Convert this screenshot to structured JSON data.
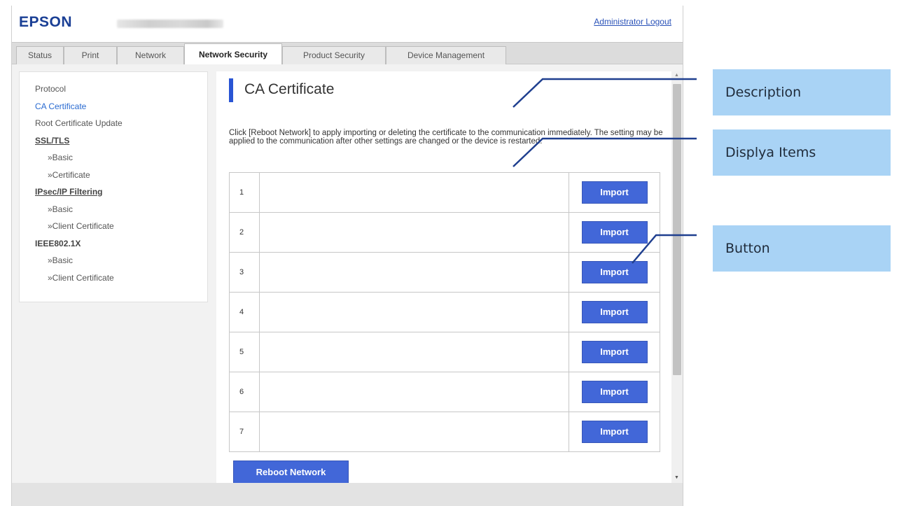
{
  "header": {
    "logo": "EPSON",
    "admin_logout": "Administrator Logout"
  },
  "tabs": [
    {
      "label": "Status"
    },
    {
      "label": "Print"
    },
    {
      "label": "Network"
    },
    {
      "label": "Network Security",
      "active": true
    },
    {
      "label": "Product Security"
    },
    {
      "label": "Device Management"
    }
  ],
  "sidebar": {
    "items": [
      {
        "label": "Protocol"
      },
      {
        "label": "CA Certificate",
        "current": true
      },
      {
        "label": "Root Certificate Update"
      },
      {
        "label": "SSL/TLS"
      },
      {
        "label": "»Basic"
      },
      {
        "label": "»Certificate"
      },
      {
        "label": "IPsec/IP Filtering"
      },
      {
        "label": "»Basic"
      },
      {
        "label": "»Client Certificate"
      },
      {
        "label": "IEEE802.1X"
      },
      {
        "label": "»Basic"
      },
      {
        "label": "»Client Certificate"
      }
    ]
  },
  "main": {
    "title": "CA Certificate",
    "description": "Click [Reboot Network] to apply importing or deleting the certificate to the communication immediately. The setting may be applied to the communication after other settings are changed or the device is restarted.",
    "rows": [
      {
        "num": "1",
        "button": "Import"
      },
      {
        "num": "2",
        "button": "Import"
      },
      {
        "num": "3",
        "button": "Import"
      },
      {
        "num": "4",
        "button": "Import"
      },
      {
        "num": "5",
        "button": "Import"
      },
      {
        "num": "6",
        "button": "Import"
      },
      {
        "num": "7",
        "button": "Import"
      }
    ],
    "reboot_button": "Reboot Network"
  },
  "annotations": [
    {
      "label": "Description"
    },
    {
      "label": "Displya Items"
    },
    {
      "label": "Button"
    }
  ],
  "colors": {
    "accent": "#4267d8",
    "logo": "#1a3f95",
    "callout": "#a9d3f5",
    "leader_line": "#1f3f8f"
  }
}
